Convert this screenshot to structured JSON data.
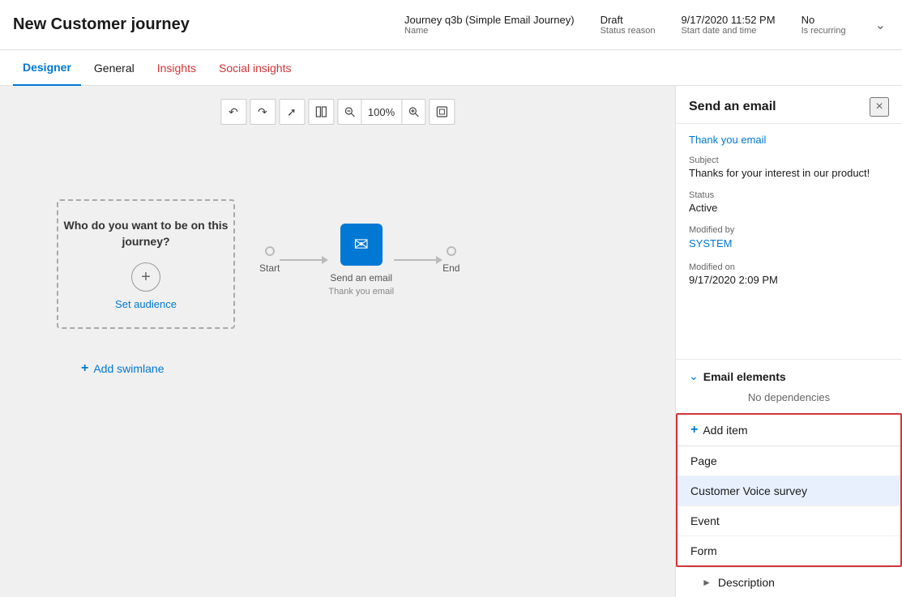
{
  "header": {
    "title": "New Customer journey",
    "meta": {
      "name_value": "Journey q3b (Simple Email Journey)",
      "name_label": "Name",
      "status_value": "Draft",
      "status_label": "Status reason",
      "date_value": "9/17/2020 11:52 PM",
      "date_label": "Start date and time",
      "recurring_value": "No",
      "recurring_label": "Is recurring"
    }
  },
  "tabs": [
    {
      "label": "Designer",
      "active": true,
      "color": "normal"
    },
    {
      "label": "General",
      "active": false,
      "color": "normal"
    },
    {
      "label": "Insights",
      "active": false,
      "color": "red"
    },
    {
      "label": "Social insights",
      "active": false,
      "color": "red"
    }
  ],
  "canvas": {
    "toolbar": {
      "undo": "↩",
      "redo": "↪",
      "expand": "⤢",
      "columns": "⊞",
      "zoom_out": "−",
      "zoom_level": "100%",
      "zoom_in": "+",
      "fit": "⊡"
    },
    "audience": {
      "text": "Who do you want to be on this journey?",
      "plus": "+",
      "link": "Set audience"
    },
    "flow": {
      "start_label": "Start",
      "email_label": "Send an email",
      "email_sublabel": "Thank you email",
      "end_label": "End"
    },
    "add_swimlane": "+ Add swimlane"
  },
  "panel": {
    "title": "Send an email",
    "close": "×",
    "email_link": "Thank you email",
    "subject_label": "Subject",
    "subject_value": "Thanks for your interest in our product!",
    "status_label": "Status",
    "status_value": "Active",
    "modified_by_label": "Modified by",
    "modified_by_link": "SYSTEM",
    "modified_on_label": "Modified on",
    "modified_on_value": "9/17/2020 2:09 PM",
    "email_elements_title": "Email elements",
    "no_dependencies": "No dependencies",
    "add_item_label": "Add item",
    "add_item_icon": "+",
    "dropdown_items": [
      {
        "label": "Page",
        "highlighted": false
      },
      {
        "label": "Customer Voice survey",
        "highlighted": true
      },
      {
        "label": "Event",
        "highlighted": false
      },
      {
        "label": "Form",
        "highlighted": false
      }
    ],
    "description_label": "Description"
  }
}
